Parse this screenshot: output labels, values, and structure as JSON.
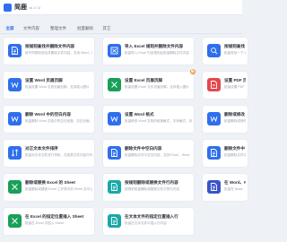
{
  "app": {
    "name": "简鹿",
    "version": "v6.17.8"
  },
  "tabs": [
    {
      "label": "全部",
      "active": true
    },
    {
      "label": "文件内容",
      "active": false
    },
    {
      "label": "整理文件",
      "active": false
    },
    {
      "label": "批量删除",
      "active": false
    },
    {
      "label": "其它",
      "active": false
    }
  ],
  "cards": [
    {
      "title": "按规则查找并删除文件内容",
      "desc": "按不同规则查找并删除文件内容，支持 Word、E",
      "color": "blue",
      "icon": "text-doc-icon"
    },
    {
      "title": "导入 Excel 规则并删除文件内容",
      "desc": "批量导入 Excel 内容规则后批量删除文件内容",
      "color": "blue",
      "icon": "excel-import-icon"
    },
    {
      "title": "按规则查找",
      "desc": "批量查找一下 Word、Excel",
      "color": "blue",
      "icon": "search-doc-icon"
    },
    {
      "title": "设置 Word 页眉页脚",
      "desc": "批量设置 Word 文档页眉页脚，支持插入图片",
      "color": "blue",
      "icon": "word-icon"
    },
    {
      "title": "设置 Excel 页眉页脚",
      "desc": "批量设置 Excel 文件页眉页脚，支持插入图片",
      "color": "green",
      "icon": "excel-icon",
      "badge": "新"
    },
    {
      "title": "设置 PDF 页眉",
      "desc": "批量设置 PDF 页眉页脚",
      "color": "red",
      "icon": "pdf-icon"
    },
    {
      "title": "删除 Word 中的空白内容",
      "desc": "批量删除 Word 文档中的空白段落、空白页面、空白",
      "color": "blue",
      "icon": "word-icon"
    },
    {
      "title": "设置 Word 格式",
      "desc": "批量修改 Word 文档的段落格式、字体格式、页面格式",
      "color": "blue",
      "icon": "word-icon"
    },
    {
      "title": "删除或修改",
      "desc": "批量删除或修改 Word 文档",
      "color": "blue",
      "icon": "word-icon"
    },
    {
      "title": "对正文本文件排序",
      "desc": "批量对文本文件进行排序，在各类文件内容行列进行。",
      "color": "blue",
      "icon": "sort-icon"
    },
    {
      "title": "删除文件中空白内容",
      "desc": "批量删除文件中空白内容，支持 Excel、Word",
      "color": "blue",
      "icon": "text-doc-icon"
    },
    {
      "title": "删除文件中",
      "desc": "批量删除文件中的",
      "color": "blue",
      "icon": "text-doc-icon"
    },
    {
      "title": "删除或替换 Excel 的 Sheet",
      "desc": "批量删除或替换 Excel 工作表中的 Sheet 并可以设置",
      "color": "green",
      "icon": "excel-icon"
    },
    {
      "title": "按规则删除或替换文件行内容",
      "desc": "按规则批量删除或替换文件中的行内容",
      "color": "teal",
      "icon": "text-doc-icon"
    },
    {
      "title": "在 Word、PDF",
      "desc": "批量在 Word、PDF 中",
      "color": "navy",
      "icon": "text-doc-icon"
    },
    {
      "title": "在 Excel 的指定位置插入 Sheet",
      "desc": "批量在 Excel 中插入 Sheet",
      "color": "green",
      "icon": "excel-icon"
    },
    {
      "title": "在文本文件的指定位置插入行",
      "desc": "批量在文本文件中插入行内容",
      "color": "teal",
      "icon": "text-doc-icon"
    }
  ]
}
